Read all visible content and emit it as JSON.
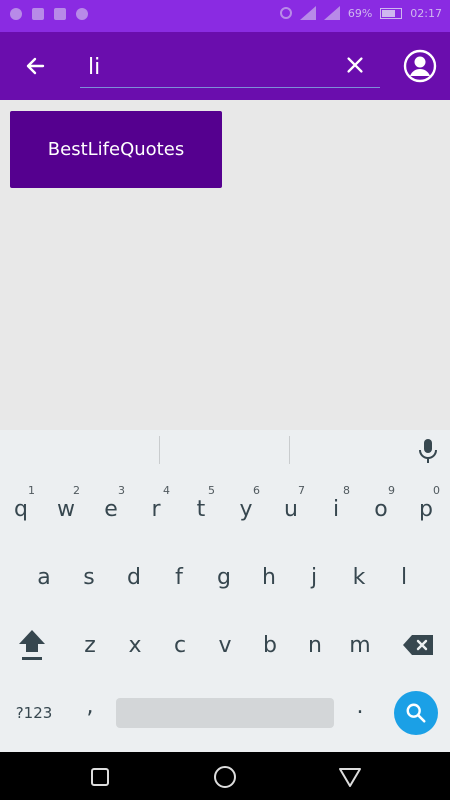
{
  "status_bar": {
    "battery": "69%",
    "time": "02:17"
  },
  "app_bar": {
    "search_value": "li",
    "icons": {
      "back": "arrow-left-icon",
      "clear": "close-icon",
      "account": "account-circle-icon"
    }
  },
  "results": [
    {
      "label": "BestLifeQuotes"
    }
  ],
  "keyboard": {
    "row1": [
      {
        "ch": "q",
        "num": "1"
      },
      {
        "ch": "w",
        "num": "2"
      },
      {
        "ch": "e",
        "num": "3"
      },
      {
        "ch": "r",
        "num": "4"
      },
      {
        "ch": "t",
        "num": "5"
      },
      {
        "ch": "y",
        "num": "6"
      },
      {
        "ch": "u",
        "num": "7"
      },
      {
        "ch": "i",
        "num": "8"
      },
      {
        "ch": "o",
        "num": "9"
      },
      {
        "ch": "p",
        "num": "0"
      }
    ],
    "row2": [
      "a",
      "s",
      "d",
      "f",
      "g",
      "h",
      "j",
      "k",
      "l"
    ],
    "row3": [
      "z",
      "x",
      "c",
      "v",
      "b",
      "n",
      "m"
    ],
    "symbols_label": "?123",
    "comma": ",",
    "period": "."
  },
  "colors": {
    "status_bar": "#8a2be2",
    "app_bar": "#6a0dad",
    "result_card": "#55008f",
    "search_key": "#1ba0e6"
  }
}
